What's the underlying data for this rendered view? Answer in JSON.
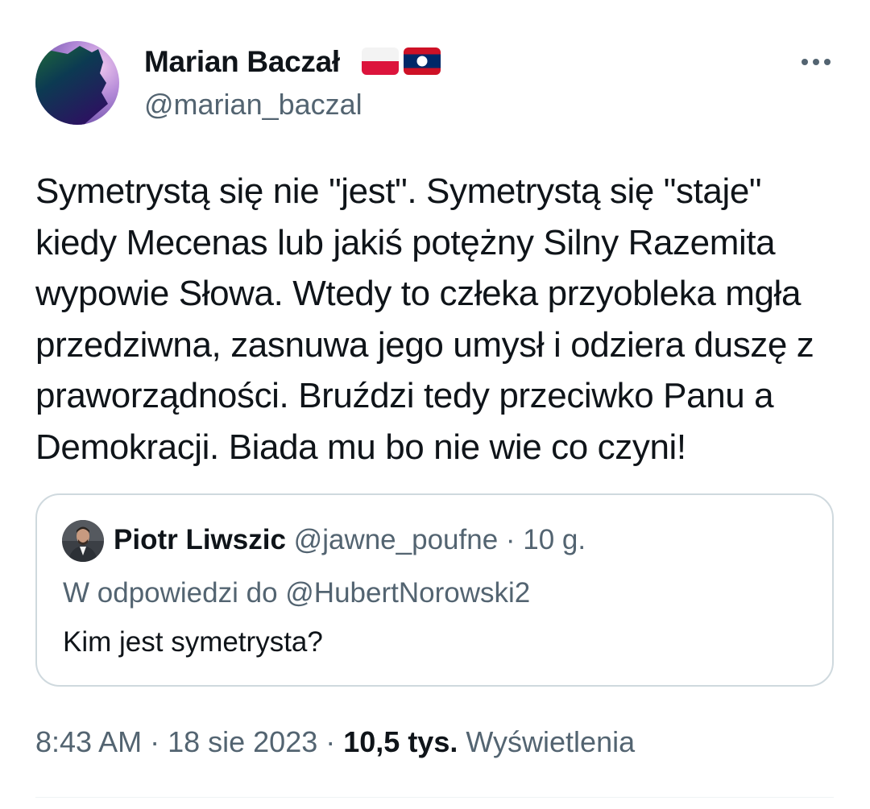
{
  "author": {
    "display_name": "Marian Baczał",
    "handle": "@marian_baczal",
    "flags": [
      "poland-flag-icon",
      "laos-flag-icon"
    ]
  },
  "menu": {
    "icon": "more-horizontal-icon"
  },
  "tweet": {
    "lines": [
      "Symetrystą się nie \"jest\". Symetrystą się \"staje\"",
      "kiedy Mecenas lub jakiś potężny Silny Razemita",
      "wypowie Słowa. Wtedy to człeka przyobleka mgła",
      "przedziwna, zasnuwa jego umysł i odziera duszę z",
      "praworządności. Bruździ tedy przeciwko Panu a",
      "Demokracji. Biada mu bo nie wie co czyni!"
    ]
  },
  "quote": {
    "display_name": "Piotr Liwszic",
    "handle": "@jawne_poufne",
    "separator": " · ",
    "time": "10 g.",
    "reply_prefix": "W odpowiedzi do ",
    "reply_to": "@HubertNorowski2",
    "text": "Kim jest symetrysta?"
  },
  "footer": {
    "time": "8:43 AM",
    "separator": " · ",
    "date": "18 sie 2023",
    "views_count": "10,5 tys.",
    "views_label": "Wyświetlenia"
  },
  "colors": {
    "text_primary": "#0f1419",
    "text_secondary": "#536471",
    "border": "#cfd9de",
    "flag_red": "#dc143c",
    "laos_blue": "#002868",
    "laos_red": "#ce1126"
  }
}
